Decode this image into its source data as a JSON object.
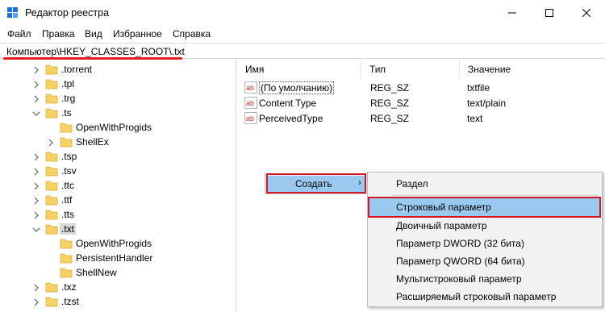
{
  "window": {
    "title": "Редактор реестра"
  },
  "menubar": [
    "Файл",
    "Правка",
    "Вид",
    "Избранное",
    "Справка"
  ],
  "address": {
    "path": "Компьютер\\HKEY_CLASSES_ROOT\\.txt"
  },
  "tree": {
    "items": [
      {
        "label": ".torrent",
        "expand": "collapsed",
        "level": 0
      },
      {
        "label": ".tpl",
        "expand": "collapsed",
        "level": 0
      },
      {
        "label": ".trg",
        "expand": "collapsed",
        "level": 0
      },
      {
        "label": ".ts",
        "expand": "expanded",
        "level": 0
      },
      {
        "label": "OpenWithProgids",
        "expand": "none",
        "level": 1
      },
      {
        "label": "ShellEx",
        "expand": "collapsed",
        "level": 1
      },
      {
        "label": ".tsp",
        "expand": "collapsed",
        "level": 0
      },
      {
        "label": ".tsv",
        "expand": "collapsed",
        "level": 0
      },
      {
        "label": ".ttc",
        "expand": "collapsed",
        "level": 0
      },
      {
        "label": ".ttf",
        "expand": "collapsed",
        "level": 0
      },
      {
        "label": ".tts",
        "expand": "collapsed",
        "level": 0
      },
      {
        "label": ".txt",
        "expand": "expanded",
        "level": 0,
        "selected": true
      },
      {
        "label": "OpenWithProgids",
        "expand": "none",
        "level": 1
      },
      {
        "label": "PersistentHandler",
        "expand": "none",
        "level": 1
      },
      {
        "label": "ShellNew",
        "expand": "none",
        "level": 1
      },
      {
        "label": ".txz",
        "expand": "collapsed",
        "level": 0
      },
      {
        "label": ".tzst",
        "expand": "collapsed",
        "level": 0
      }
    ]
  },
  "columns": {
    "name": "Имя",
    "type": "Тип",
    "value": "Значение"
  },
  "values": [
    {
      "name": "(По умолчанию)",
      "type": "REG_SZ",
      "data": "txtfile"
    },
    {
      "name": "Content Type",
      "type": "REG_SZ",
      "data": "text/plain"
    },
    {
      "name": "PerceivedType",
      "type": "REG_SZ",
      "data": "text"
    }
  ],
  "context_menu": {
    "create_label": "Создать",
    "arrow": "›"
  },
  "submenu": {
    "items": [
      "Раздел",
      "Строковый параметр",
      "Двоичный параметр",
      "Параметр DWORD (32 бита)",
      "Параметр QWORD (64 бита)",
      "Мультистроковый параметр",
      "Расширяемый строковый параметр"
    ]
  },
  "colors": {
    "highlight": "#99c9ef",
    "annotation_red": "#d3162a",
    "folder": "#f6d166"
  }
}
